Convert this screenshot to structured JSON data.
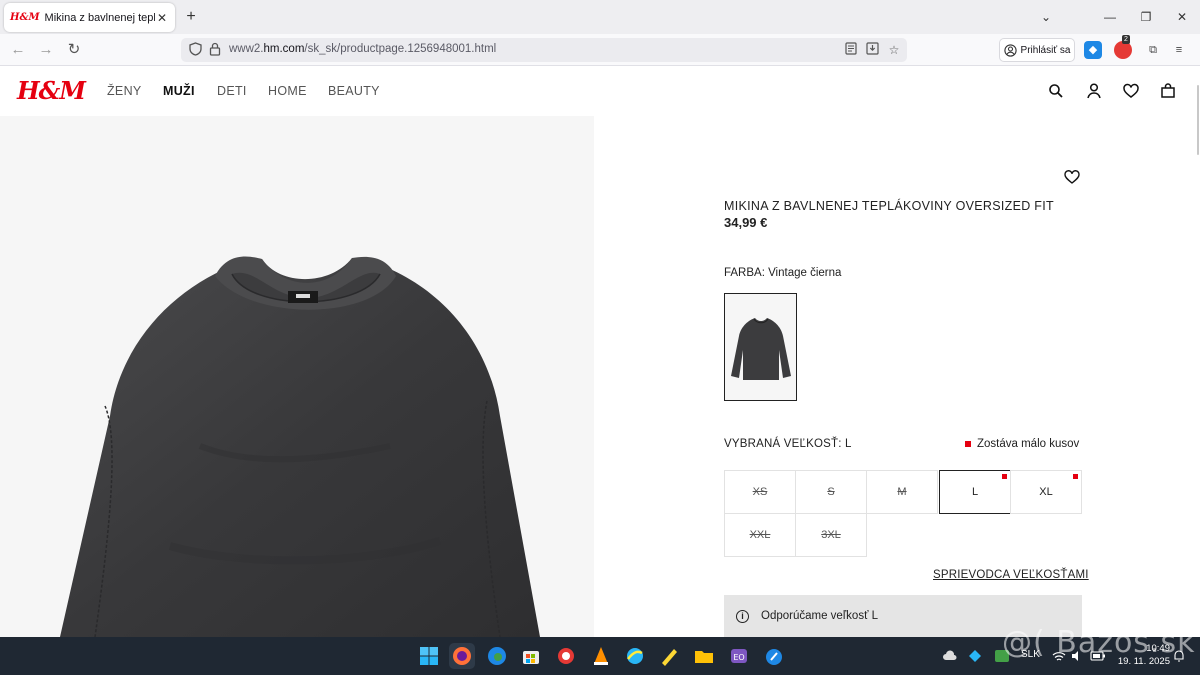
{
  "browser": {
    "tab_title": "Mikina z bavlnenej teplákoviny",
    "tab_favicon": "H&M",
    "url_prefix": "www2.",
    "url_domain": "hm.com",
    "url_path": "/sk_sk/productpage.1256948001.html",
    "signin_label": "Prihlásiť sa",
    "ext_badge": "2"
  },
  "site": {
    "logo": "H&M",
    "categories": [
      "ŽENY",
      "MUŽI",
      "DETI",
      "HOME",
      "BEAUTY"
    ],
    "active_category": "MUŽI"
  },
  "product": {
    "title": "MIKINA Z BAVLNENEJ TEPLÁKOVINY OVERSIZED FIT",
    "price": "34,99 €",
    "color_label": "FARBA: Vintage čierna",
    "selected_size_label": "VYBRANÁ VEĽKOSŤ: L",
    "low_stock": "Zostáva málo kusov",
    "sizes": [
      {
        "label": "XS",
        "available": false,
        "selected": false,
        "low": false
      },
      {
        "label": "S",
        "available": false,
        "selected": false,
        "low": false
      },
      {
        "label": "M",
        "available": false,
        "selected": false,
        "low": false
      },
      {
        "label": "L",
        "available": true,
        "selected": true,
        "low": true
      },
      {
        "label": "XL",
        "available": true,
        "selected": false,
        "low": true
      },
      {
        "label": "XXL",
        "available": false,
        "selected": false,
        "low": false
      },
      {
        "label": "3XL",
        "available": false,
        "selected": false,
        "low": false
      }
    ],
    "size_guide": "SPRIEVODCA VEĽKOSŤAMI",
    "recommendation": "Odporúčame veľkosť L"
  },
  "taskbar": {
    "lang": "SLK",
    "time": "10:49",
    "date": "19. 11. 2025",
    "watermark": "@( Bazos.sk"
  },
  "colors": {
    "brand_red": "#e50010",
    "taskbar": "#1f2833",
    "garment": "#3a3a3c"
  }
}
